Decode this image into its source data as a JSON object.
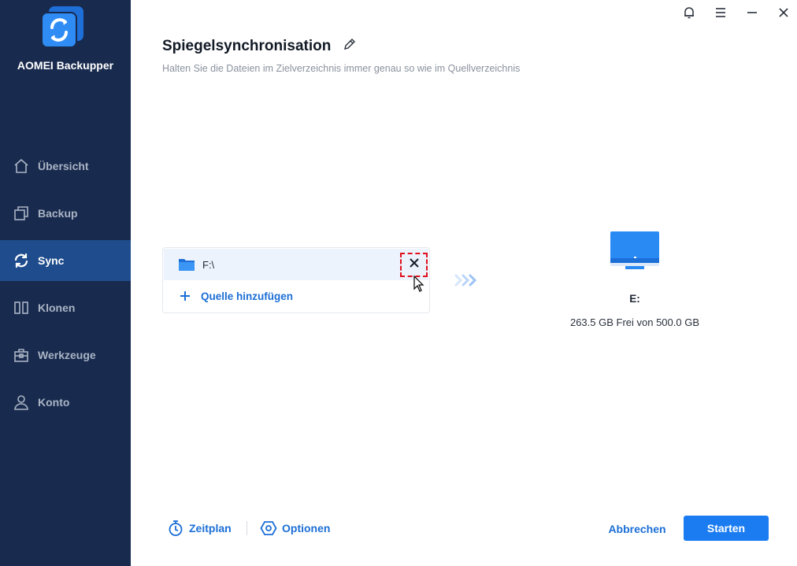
{
  "app": {
    "name": "AOMEI Backupper",
    "logo_icon": "sync-logo-icon"
  },
  "window_controls": [
    {
      "name": "notification-bell-icon"
    },
    {
      "name": "menu-icon"
    },
    {
      "name": "minimize-icon"
    },
    {
      "name": "close-icon"
    }
  ],
  "sidebar": {
    "items": [
      {
        "label": "Übersicht",
        "icon": "home-icon",
        "active": false
      },
      {
        "label": "Backup",
        "icon": "backup-icon",
        "active": false
      },
      {
        "label": "Sync",
        "icon": "sync-icon",
        "active": true
      },
      {
        "label": "Klonen",
        "icon": "clone-icon",
        "active": false
      },
      {
        "label": "Werkzeuge",
        "icon": "toolbox-icon",
        "active": false
      },
      {
        "label": "Konto",
        "icon": "user-icon",
        "active": false
      }
    ]
  },
  "header": {
    "title": "Spiegelsynchronisation",
    "subtitle": "Halten Sie die Dateien im Zielverzeichnis immer genau so wie im Quellverzeichnis"
  },
  "source": {
    "path": "F:\\",
    "add_label": "Quelle hinzufügen"
  },
  "destination": {
    "label": "E:",
    "space": "263.5 GB Frei von 500.0 GB"
  },
  "footer": {
    "schedule_label": "Zeitplan",
    "options_label": "Optionen",
    "cancel_label": "Abbrechen",
    "start_label": "Starten"
  },
  "colors": {
    "sidebar_bg": "#182a4e",
    "sidebar_active": "#1e4c8c",
    "accent": "#1b7cf2",
    "link": "#1b6ed6",
    "highlight_border": "#e0101d"
  }
}
